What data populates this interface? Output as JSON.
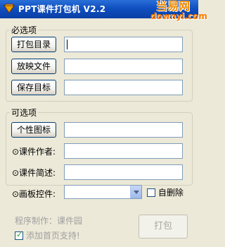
{
  "window": {
    "title": "PPT课件打包机 V2.2",
    "watermark_top": "当易网",
    "watermark_bottom": "downyi.com"
  },
  "required_group": {
    "title": "必选项",
    "buttons": [
      {
        "label": "打包目录",
        "value": ""
      },
      {
        "label": "放映文件",
        "value": ""
      },
      {
        "label": "保存目标",
        "value": ""
      }
    ]
  },
  "optional_group": {
    "title": "可选项",
    "icon_button_label": "个性图标",
    "icon_value": "",
    "author_label": "⊙课件作者:",
    "author_value": "",
    "summary_label": "⊙课件简述:",
    "summary_value": "",
    "plugin_label": "⊙画板控件:",
    "plugin_value": "",
    "auto_delete_label": "自删除",
    "auto_delete_checked": false
  },
  "footer": {
    "credit": "程序制作：课件园",
    "homepage_label": "添加首页支持!",
    "homepage_checked": true,
    "pack_label": "打包"
  },
  "colors": {
    "titlebar": "#0a3fa6",
    "face": "#ece9d8",
    "disabled_text": "#a0a0a0"
  }
}
